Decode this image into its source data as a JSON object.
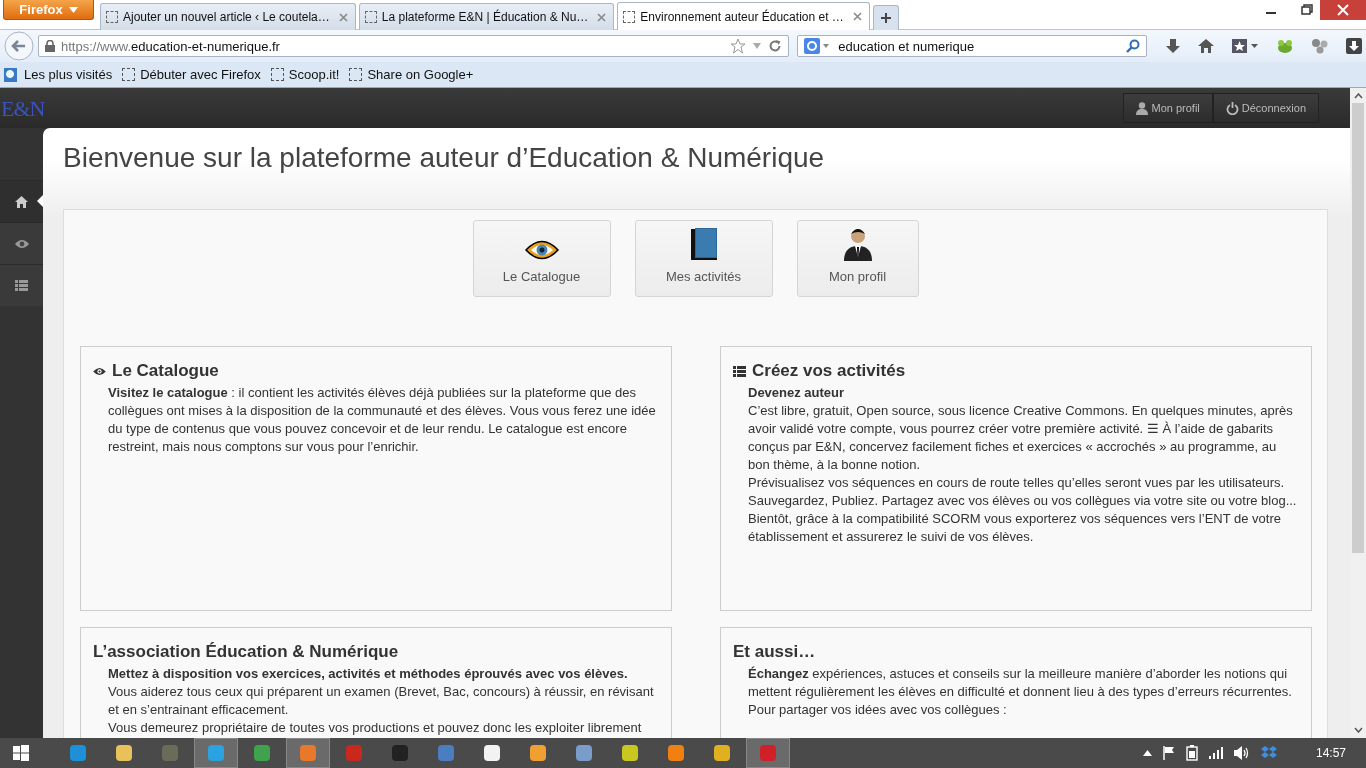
{
  "browser": {
    "menu_button": "Firefox",
    "tabs": [
      {
        "title": "Ajouter un nouvel article ‹ Le coutela…",
        "selected": false
      },
      {
        "title": "La plateforme E&N | Éducation & Nu…",
        "selected": false
      },
      {
        "title": "Environnement auteur Éducation et …",
        "selected": true
      }
    ],
    "url": {
      "prefix": "https://www.",
      "domain": "education-et-numerique.fr"
    },
    "search": {
      "value": "education et numerique"
    },
    "bookmarks": [
      {
        "kind": "library",
        "label": "Les plus visités"
      },
      {
        "kind": "page",
        "label": "Débuter avec Firefox"
      },
      {
        "kind": "page",
        "label": "Scoop.it!"
      },
      {
        "kind": "page",
        "label": "Share on Google+"
      }
    ]
  },
  "header": {
    "logo": "E&N",
    "buttons": [
      {
        "kind": "profile",
        "label": "Mon profil"
      },
      {
        "kind": "logout",
        "label": "Déconnexion"
      }
    ]
  },
  "sidebar": {
    "items": [
      {
        "kind": "home",
        "selected": true
      },
      {
        "kind": "eye",
        "selected": false
      },
      {
        "kind": "list",
        "selected": false
      }
    ]
  },
  "page": {
    "title": "Bienvenue sur la plateforme auteur d’Education & Numérique",
    "shortcuts": [
      {
        "kind": "eye",
        "label": "Le Catalogue"
      },
      {
        "kind": "book",
        "label": "Mes activités"
      },
      {
        "kind": "person",
        "label": "Mon profil"
      }
    ],
    "cards": [
      {
        "kind": "eye",
        "heading": "Le Catalogue",
        "paragraphs": [
          {
            "kind": "text",
            "text": "**Visitez le catalogue** : il contient les activités élèves déjà publiées sur la plateforme que des collègues ont mises à la disposition de la communauté et des élèves. Vous vous ferez une idée du type de contenus que vous pouvez concevoir et de leur rendu. Le catalogue est encore restreint, mais nous comptons sur vous pour l’enrichir."
          }
        ]
      },
      {
        "kind": "list",
        "heading": "Créez vos activités",
        "paragraphs": [
          {
            "kind": "lead",
            "text": "Devenez auteur"
          },
          {
            "kind": "text",
            "text": "C’est libre, gratuit, Open source, sous licence Creative Commons. En quelques minutes, après avoir validé votre compte, vous pourrez créer votre première activité. ☰ À l’aide de gabarits conçus par E&N, concervez facilement fiches et exercices « accrochés » au programme, au bon thème, à la bonne notion."
          },
          {
            "kind": "text",
            "text": "Prévisualisez vos séquences en cours de route telles qu’elles seront vues par les utilisateurs. Sauvegardez, Publiez. Partagez avec vos élèves ou vos collègues via votre site ou votre blog... Bientôt, grâce à la compatibilité SCORM vous exporterez vos séquences vers l’ENT de votre établissement et assurerez le suivi de vos élèves."
          }
        ]
      },
      {
        "kind": "plain",
        "heading": "L’association Éducation & Numérique",
        "paragraphs": [
          {
            "kind": "lead",
            "text": "Mettez à disposition vos exercices, activités et méthodes éprouvés avec vos élèves."
          },
          {
            "kind": "text",
            "text": "Vous aiderez tous ceux qui préparent un examen (Brevet, Bac, concours) à réussir, en révisant et en s’entrainant efficacement."
          },
          {
            "kind": "text",
            "text": "Vous demeurez propriétaire de toutes vos productions et pouvez donc les exploiter librement"
          }
        ]
      },
      {
        "kind": "plain",
        "heading": "Et aussi…",
        "paragraphs": [
          {
            "kind": "text",
            "text": "**Échangez** expériences, astuces et conseils sur la meilleure manière d’aborder les notions qui mettent régulièrement les élèves en difficulté et donnent lieu à des types d’erreurs récurrentes."
          },
          {
            "kind": "text",
            "text": "Pour partager vos idées avec vos collègues :"
          }
        ]
      }
    ]
  },
  "taskbar": {
    "apps": [
      {
        "color": "#1e90d8",
        "selected": false
      },
      {
        "color": "#e8c15a",
        "selected": false
      },
      {
        "color": "#6b6b5a",
        "selected": false
      },
      {
        "color": "#2aa3e0",
        "selected": true
      },
      {
        "color": "#3fa34d",
        "selected": false
      },
      {
        "color": "#e8782a",
        "selected": true
      },
      {
        "color": "#c8281e",
        "selected": false
      },
      {
        "color": "#222222",
        "selected": false
      },
      {
        "color": "#4a7ec0",
        "selected": false
      },
      {
        "color": "#f2f2f2",
        "selected": false
      },
      {
        "color": "#f0a030",
        "selected": false
      },
      {
        "color": "#7a9cc8",
        "selected": false
      },
      {
        "color": "#c8c820",
        "selected": false
      },
      {
        "color": "#f08010",
        "selected": false
      },
      {
        "color": "#e0b020",
        "selected": false
      },
      {
        "color": "#d0202a",
        "selected": true
      }
    ],
    "clock": "14:57"
  }
}
